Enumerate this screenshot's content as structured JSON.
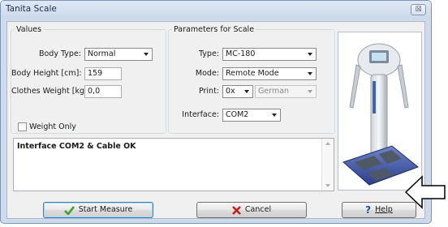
{
  "window": {
    "title": "Tanita Scale",
    "close_symbol": "☒"
  },
  "values": {
    "legend": "Values",
    "body_type": {
      "label": "Body Type:",
      "value": "Normal"
    },
    "body_height": {
      "label": "Body Height [cm]:",
      "value": "159"
    },
    "clothes_weight": {
      "label": "Clothes Weight [kg]:",
      "value": "0,0"
    },
    "weight_only": {
      "label": "Weight Only",
      "checked": false
    }
  },
  "params": {
    "legend": "Parameters for Scale",
    "type": {
      "label": "Type:",
      "value": "MC-180"
    },
    "mode": {
      "label": "Mode:",
      "value": "Remote Mode"
    },
    "print": {
      "label": "Print:",
      "value": "0x",
      "language": "German"
    },
    "interface": {
      "label": "Interface:",
      "value": "COM2"
    }
  },
  "status": {
    "text": "Interface COM2 & Cable OK"
  },
  "buttons": {
    "start": {
      "label": "Start Measure",
      "icon": "checkmark-icon",
      "color": "#3aa12b"
    },
    "cancel": {
      "label": "Cancel",
      "icon": "x-icon",
      "color": "#c0201a"
    },
    "help": {
      "label": "Help",
      "icon": "question-icon",
      "color": "#1a4fb0"
    }
  },
  "image": {
    "subject": "scale-device-image"
  }
}
